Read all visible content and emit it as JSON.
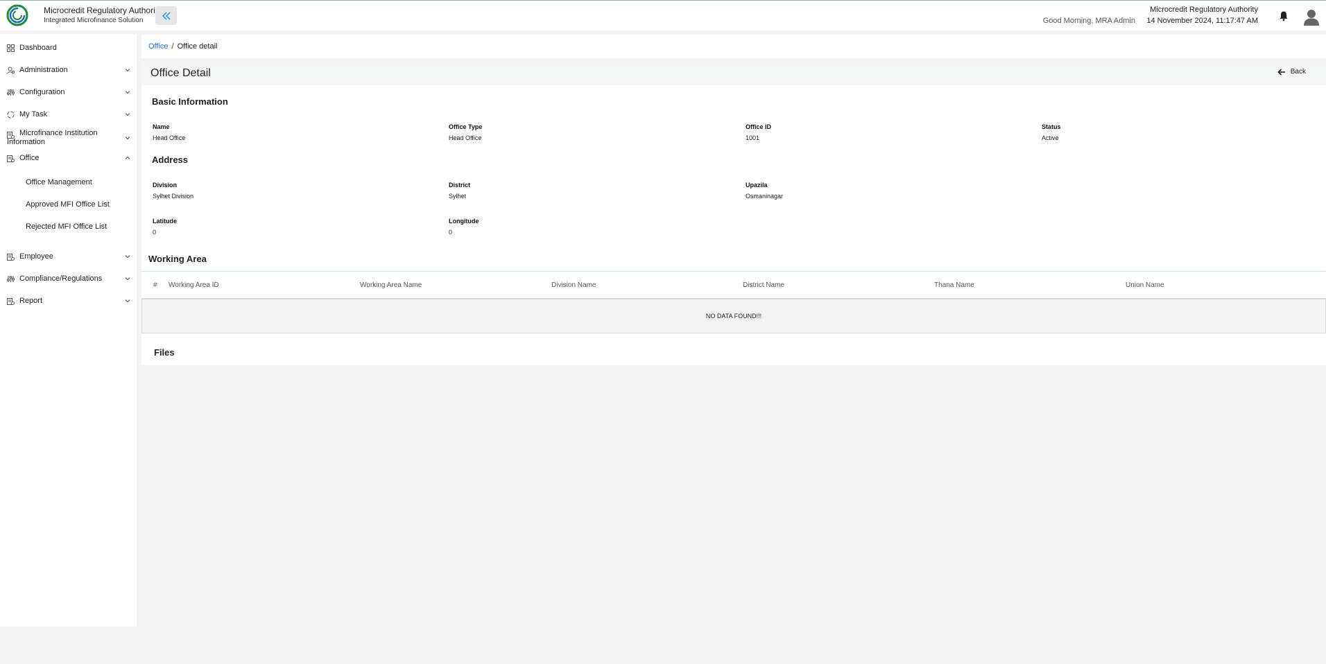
{
  "header": {
    "brand_title": "Microcredit Regulatory Authority",
    "brand_subtitle": "Integrated Microfinance Solution",
    "logo_text": "Microcredit Regulatory Authority",
    "greeting": "Good Morning, MRA Admin",
    "org_name": "Microcredit Regulatory Authority",
    "datetime": "14 November 2024, 11:17:47 AM",
    "collapse_icon": "double-chevron-left-icon",
    "notification_icon": "bell-icon",
    "avatar_icon": "user-avatar-icon"
  },
  "sidebar": {
    "items": [
      {
        "label": "Dashboard",
        "icon": "grid-icon"
      },
      {
        "label": "Administration",
        "icon": "user-cog-icon"
      },
      {
        "label": "Configuration",
        "icon": "sliders-icon"
      },
      {
        "label": "My Task",
        "icon": "task-icon"
      },
      {
        "label": "Microfinance Institution Information",
        "icon": "institution-icon"
      },
      {
        "label": "Office",
        "icon": "office-icon"
      },
      {
        "label": "Employee",
        "icon": "employee-icon"
      },
      {
        "label": "Compliance/Regulations",
        "icon": "sliders-icon"
      },
      {
        "label": "Report",
        "icon": "report-icon"
      }
    ],
    "office_subitems": [
      "Office Management",
      "Approved MFI Office List",
      "Rejected MFI Office List"
    ]
  },
  "breadcrumb": {
    "link": "Office",
    "separator": "/",
    "current": "Office detail"
  },
  "page": {
    "title": "Office Detail",
    "back_label": "Back"
  },
  "basic_info": {
    "title": "Basic Information",
    "fields": [
      {
        "label": "Name",
        "value": "Head Office"
      },
      {
        "label": "Office Type",
        "value": "Head Office"
      },
      {
        "label": "Office ID",
        "value": "1001"
      },
      {
        "label": "Status",
        "value": "Active"
      }
    ]
  },
  "address": {
    "title": "Address",
    "fields": [
      {
        "label": "Division",
        "value": "Sylhet Division"
      },
      {
        "label": "District",
        "value": "Sylhet"
      },
      {
        "label": "Upazila",
        "value": "Osmaninagar"
      },
      {
        "label": "Latitude",
        "value": "0"
      },
      {
        "label": "Longitude",
        "value": "0"
      }
    ]
  },
  "working_area": {
    "title": "Working Area",
    "columns": [
      "#",
      "Working Area ID",
      "Working Area Name",
      "Division Name",
      "District Name",
      "Thana Name",
      "Union Name"
    ],
    "empty_text": "NO DATA FOUND!!!"
  },
  "files": {
    "title": "Files"
  },
  "colors": {
    "link": "#1a73e8",
    "accent": "#3a9bd9",
    "background": "#f3f3f3"
  }
}
